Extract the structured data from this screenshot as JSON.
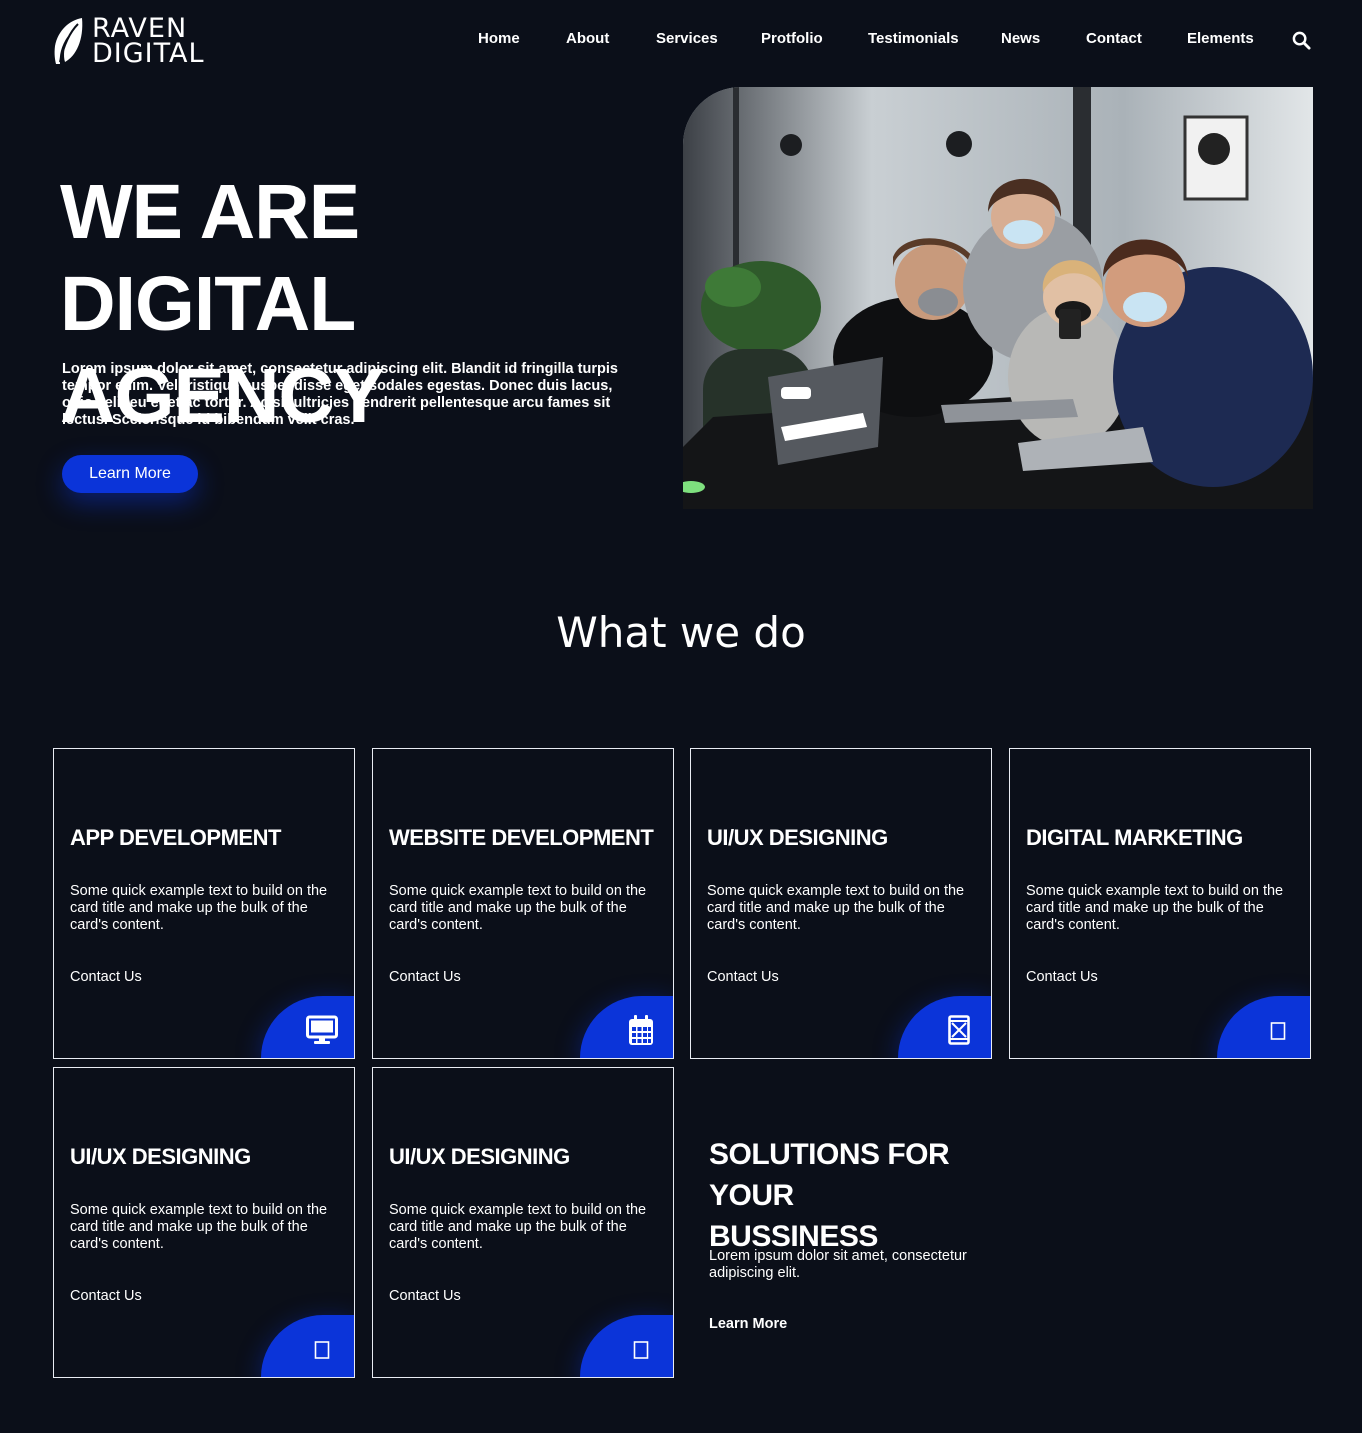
{
  "brand": {
    "line1": "RAVEN",
    "line2": "DIGITAL"
  },
  "nav": {
    "items": [
      "Home",
      "About",
      "Services",
      "Protfolio",
      "Testimonials",
      "News",
      "Contact",
      "Elements"
    ]
  },
  "hero": {
    "title_line1": "WE ARE DIGITAL",
    "title_line2": "AGENCY",
    "text": "Lorem ipsum dolor sit amet, consectetur adipiscing elit. Blandit id fringilla turpis tempor enim. Vel tristique suspendisse eget sodales egestas. Donec duis lacus, odio velit eu eget ac tortor. Ac sit ultricies hendrerit pellentesque arcu fames sit lectus. Scelerisque id bibendum velit cras.",
    "button_label": "Learn More"
  },
  "services": {
    "heading": "What we do",
    "cards": [
      {
        "title": "APP DEVELOPMENT",
        "text": "Some quick example text to build on the card title and make up the bulk of the card's content.",
        "link": "Contact Us",
        "icon": "desktop-icon"
      },
      {
        "title": "WEBSITE DEVELOPMENT",
        "text": "Some quick example text to build on the card title and make up the bulk of the card's content.",
        "link": "Contact Us",
        "icon": "calendar-icon"
      },
      {
        "title": "UI/UX DESIGNING",
        "text": "Some quick example text to build on the card title and make up the bulk of the card's content.",
        "link": "Contact Us",
        "icon": "mobile-icon"
      },
      {
        "title": "DIGITAL MARKETING",
        "text": "Some quick example text to build on the card title and make up the bulk of the card's content.",
        "link": "Contact Us",
        "icon": "missing-glyph-icon"
      },
      {
        "title": "UI/UX DESIGNING",
        "text": "Some quick example text to build on the card title and make up the bulk of the card's content.",
        "link": "Contact Us",
        "icon": "missing-glyph-icon"
      },
      {
        "title": "UI/UX DESIGNING",
        "text": "Some quick example text to build on the card title and make up the bulk of the card's content.",
        "link": "Contact Us",
        "icon": "missing-glyph-icon"
      }
    ]
  },
  "solutions": {
    "title_line1": "SOLUTIONS FOR YOUR",
    "title_line2": "BUSSINESS",
    "text": "Lorem ipsum dolor sit amet, consectetur adipiscing elit.",
    "link": "Learn More"
  },
  "colors": {
    "background": "#0b0f19",
    "accent": "#0b34d9",
    "card_border": "#e9ecf3",
    "text": "#ffffff"
  }
}
